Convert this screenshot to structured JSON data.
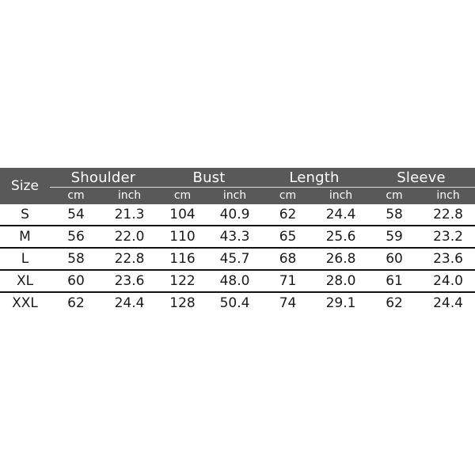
{
  "table": {
    "size_header": "Size",
    "groups": [
      {
        "label": "Shoulder",
        "units": [
          "cm",
          "inch"
        ]
      },
      {
        "label": "Bust",
        "units": [
          "cm",
          "inch"
        ]
      },
      {
        "label": "Length",
        "units": [
          "cm",
          "inch"
        ]
      },
      {
        "label": "Sleeve",
        "units": [
          "cm",
          "inch"
        ]
      }
    ],
    "rows": [
      {
        "size": "S",
        "shoulder_cm": "54",
        "shoulder_inch": "21.3",
        "bust_cm": "104",
        "bust_inch": "40.9",
        "length_cm": "62",
        "length_inch": "24.4",
        "sleeve_cm": "58",
        "sleeve_inch": "22.8"
      },
      {
        "size": "M",
        "shoulder_cm": "56",
        "shoulder_inch": "22.0",
        "bust_cm": "110",
        "bust_inch": "43.3",
        "length_cm": "65",
        "length_inch": "25.6",
        "sleeve_cm": "59",
        "sleeve_inch": "23.2"
      },
      {
        "size": "L",
        "shoulder_cm": "58",
        "shoulder_inch": "22.8",
        "bust_cm": "116",
        "bust_inch": "45.7",
        "length_cm": "68",
        "length_inch": "26.8",
        "sleeve_cm": "60",
        "sleeve_inch": "23.6"
      },
      {
        "size": "XL",
        "shoulder_cm": "60",
        "shoulder_inch": "23.6",
        "bust_cm": "122",
        "bust_inch": "48.0",
        "length_cm": "71",
        "length_inch": "28.0",
        "sleeve_cm": "61",
        "sleeve_inch": "24.0"
      },
      {
        "size": "XXL",
        "shoulder_cm": "62",
        "shoulder_inch": "24.4",
        "bust_cm": "128",
        "bust_inch": "50.4",
        "length_cm": "74",
        "length_inch": "29.1",
        "sleeve_cm": "62",
        "sleeve_inch": "24.4"
      }
    ]
  },
  "colors": {
    "header_background": "#595959",
    "header_text": "#ffffff",
    "row_text": "#1a1a1a",
    "row_separator": "#111111",
    "page_background": "#ffffff"
  }
}
